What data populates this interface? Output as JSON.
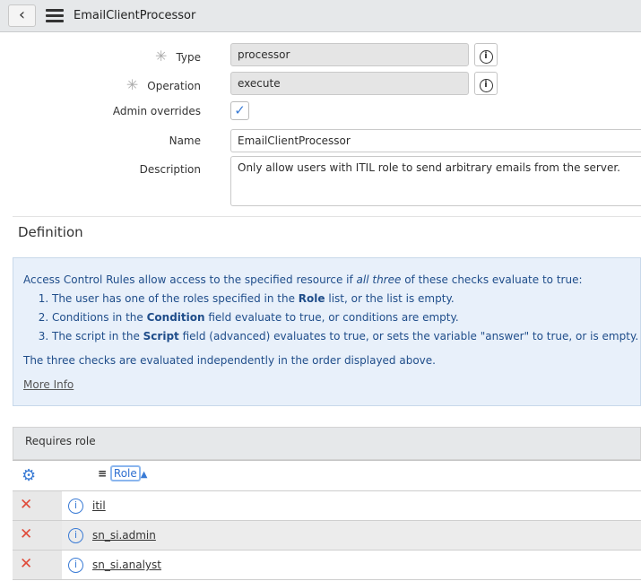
{
  "header": {
    "title": "EmailClientProcessor",
    "back_icon": "chevron-left",
    "menu_icon": "hamburger"
  },
  "form": {
    "type": {
      "label": "Type",
      "value": "processor"
    },
    "operation": {
      "label": "Operation",
      "value": "execute"
    },
    "admin_overrides": {
      "label": "Admin overrides",
      "checked": true
    },
    "name": {
      "label": "Name",
      "value": "EmailClientProcessor"
    },
    "description": {
      "label": "Description",
      "value": "Only allow users with ITIL role to send arbitrary emails from the server."
    }
  },
  "definition": {
    "heading": "Definition",
    "intro_a": "Access Control Rules allow access to the specified resource if ",
    "intro_em": "all three",
    "intro_b": " of these checks evaluate to true:",
    "items": [
      {
        "a": "The user has one of the roles specified in the ",
        "b": "Role",
        "c": " list, or the list is empty."
      },
      {
        "a": "Conditions in the ",
        "b": "Condition",
        "c": " field evaluate to true, or conditions are empty."
      },
      {
        "a": "The script in the ",
        "b": "Script",
        "c": " field (advanced) evaluates to true, or sets the variable \"answer\" to true, or is empty."
      }
    ],
    "footer": "The three checks are evaluated independently in the order displayed above.",
    "more_info": "More Info"
  },
  "requires_role": {
    "title": "Requires role",
    "column": "Role",
    "rows": [
      "itil",
      "sn_si.admin",
      "sn_si.analyst"
    ]
  }
}
